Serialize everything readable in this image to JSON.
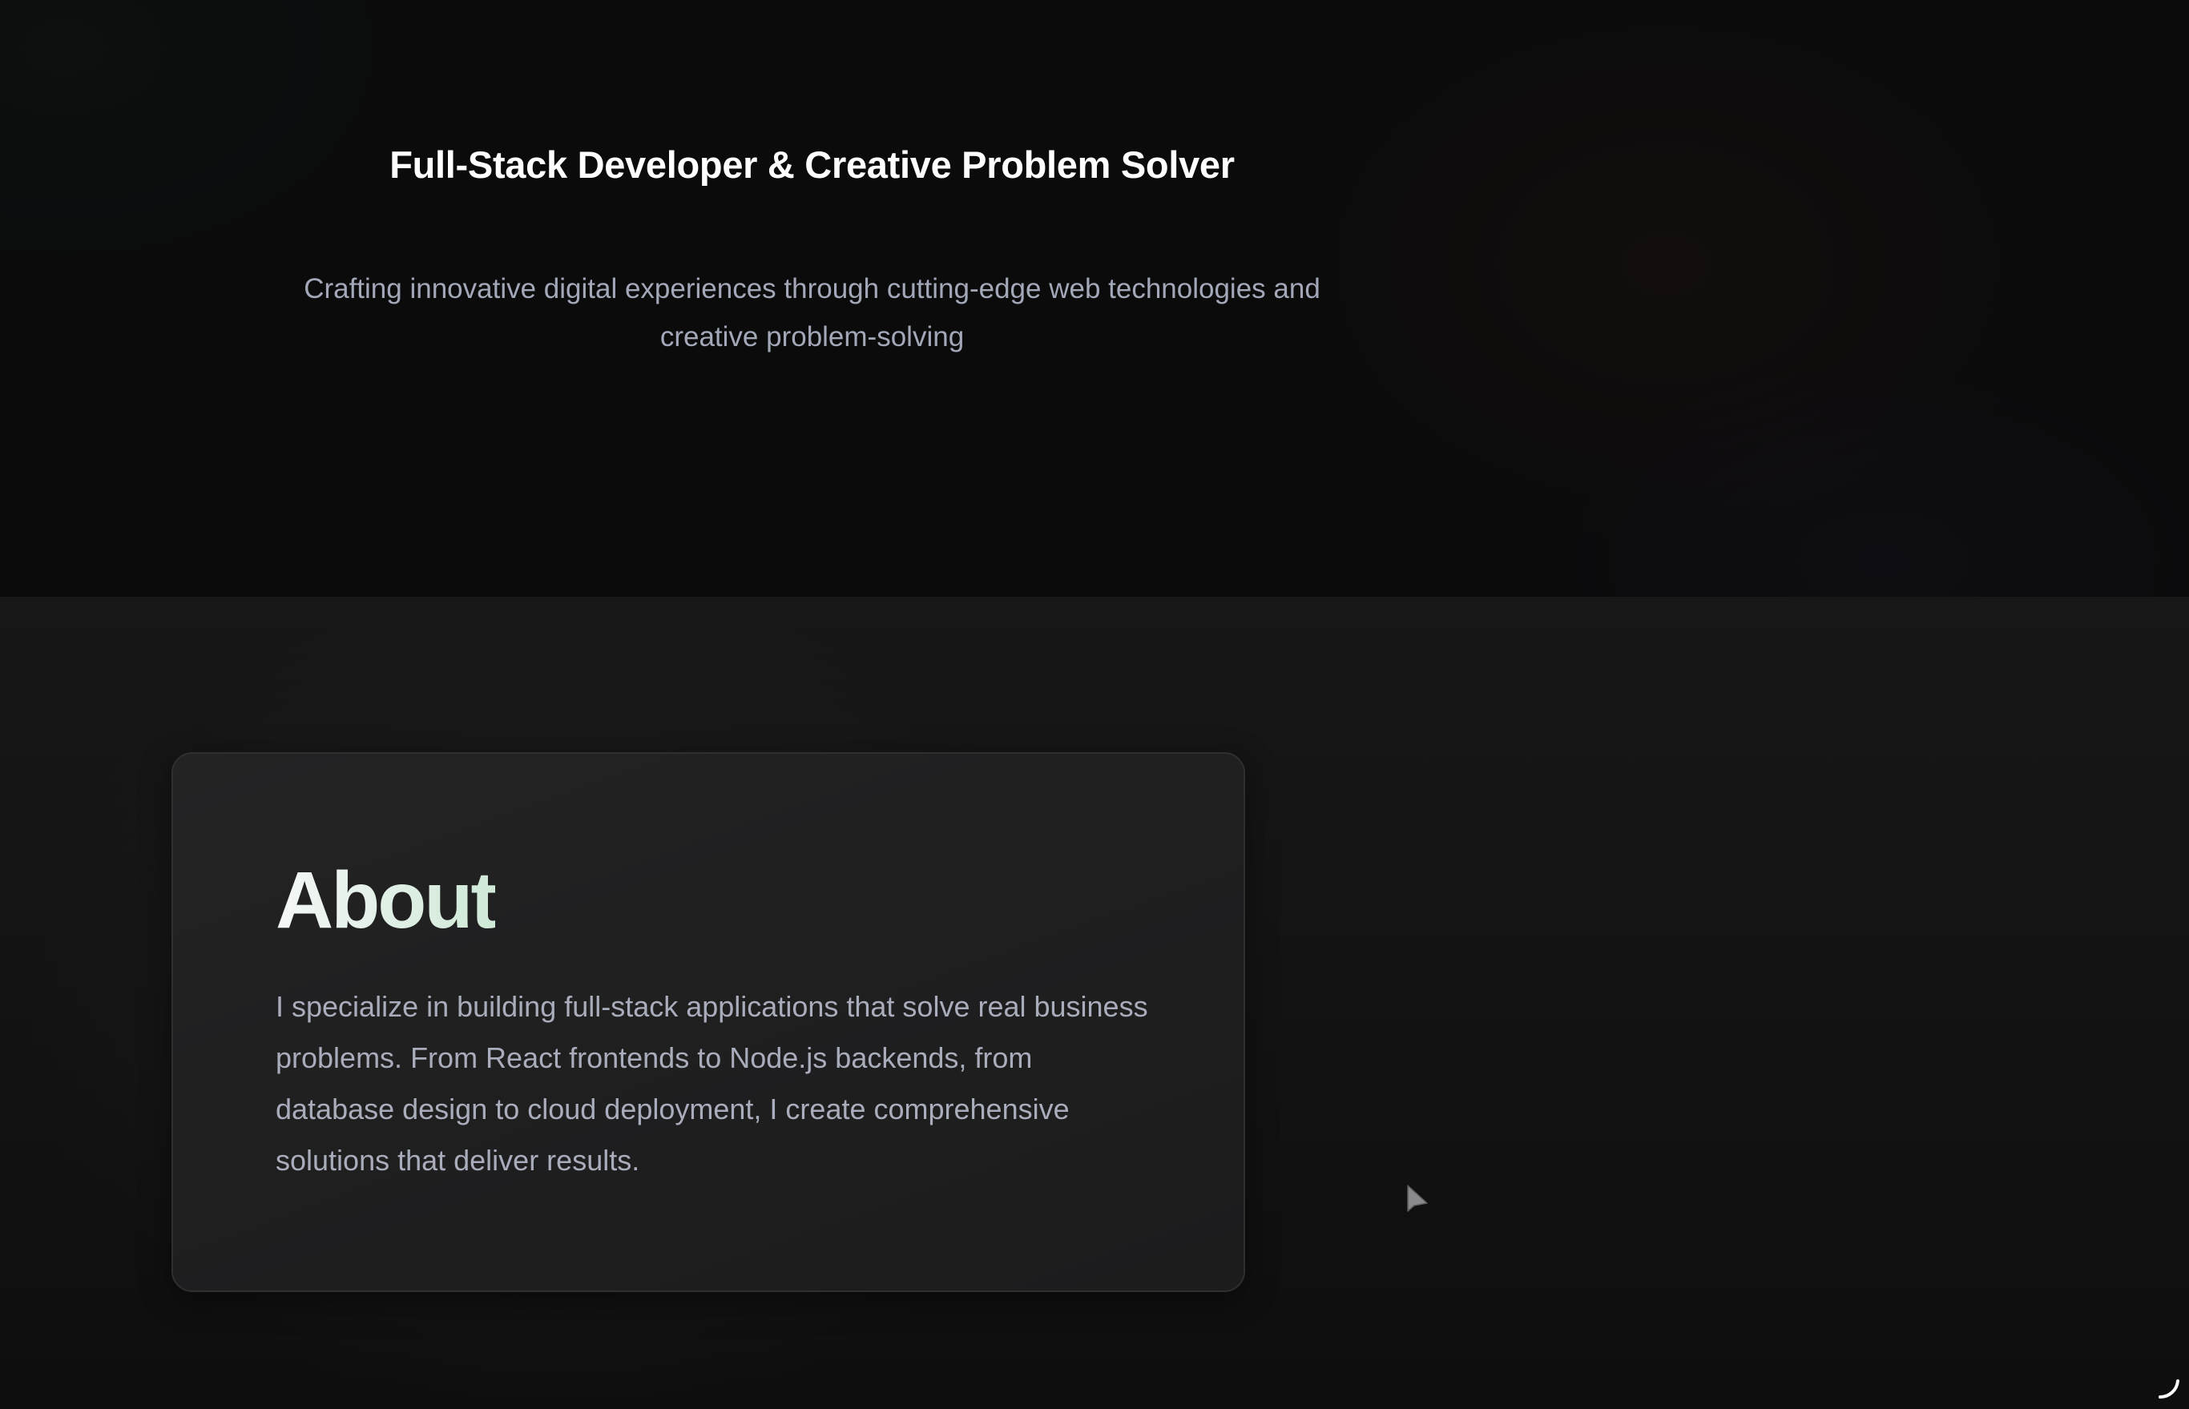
{
  "hero": {
    "title": "Full-Stack Developer & Creative Problem Solver",
    "subtitle": "Crafting innovative digital experiences through cutting-edge web technologies and creative problem-solving"
  },
  "about": {
    "heading": "About",
    "body": "I specialize in building full-stack applications that solve real business problems. From React frontends to Node.js backends, from database design to cloud deployment, I create comprehensive solutions that deliver results."
  },
  "icons": {
    "cursor": "mouse-pointer-icon",
    "corner": "loading-spinner-icon"
  },
  "colors": {
    "background": "#0b0b0c",
    "section_background": "#171717",
    "card_background": "#1f1f20",
    "title_text": "#ffffff",
    "muted_text": "#a3a8b8",
    "about_heading_gradient_end": "#cfe9d7"
  }
}
